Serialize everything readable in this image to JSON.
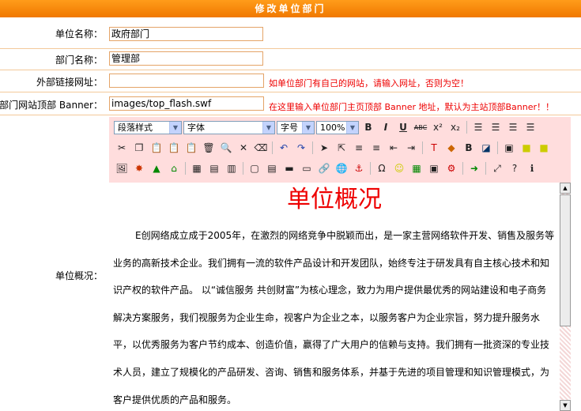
{
  "header": {
    "title": "修改单位部门"
  },
  "form": {
    "unit_name_label": "单位名称：",
    "unit_name_value": "政府部门",
    "dept_name_label": "部门名称：",
    "dept_name_value": "管理部",
    "external_link_label": "外部链接网址：",
    "external_link_value": "",
    "external_link_hint": "如单位部门有自己的网站，请输入网址，否则为空！",
    "banner_label": "部门网站顶部 Banner：",
    "banner_value": "images/top_flash.swf",
    "banner_hint": "在这里输入单位部门主页顶部 Banner 地址，默认为主站顶部Banner！！",
    "overview_label": "单位概况："
  },
  "editor": {
    "paragraph_style": "段落样式",
    "font_family": "字体",
    "font_size": "字号",
    "zoom": "100%",
    "doc_title": "单位概况",
    "doc_body": "E创网络成立成于2005年，在激烈的网络竞争中脱颖而出，是一家主营网络软件开发、销售及服务等业务的高新技术企业。我们拥有一流的软件产品设计和开发团队，始终专注于研发具有自主核心技术和知识产权的软件产品。 以“诚信服务  共创财富”为核心理念，致力为用户提供最优秀的网站建设和电子商务解决方案服务，我们视服务为企业生命，视客户为企业之本，以服务客户为企业宗旨，努力提升服务水平，以优秀服务为客户节约成本、创造价值，赢得了广大用户的信赖与支持。我们拥有一批资深的专业技术人员，建立了规模化的产品研发、咨询、销售和服务体系，并基于先进的项目管理和知识管理模式，为客户提供优质的产品和服务。"
  },
  "colors": {
    "header_orange": "#f58a10",
    "hint_red": "#ee0000",
    "toolbar_pink": "#ffdddd"
  }
}
